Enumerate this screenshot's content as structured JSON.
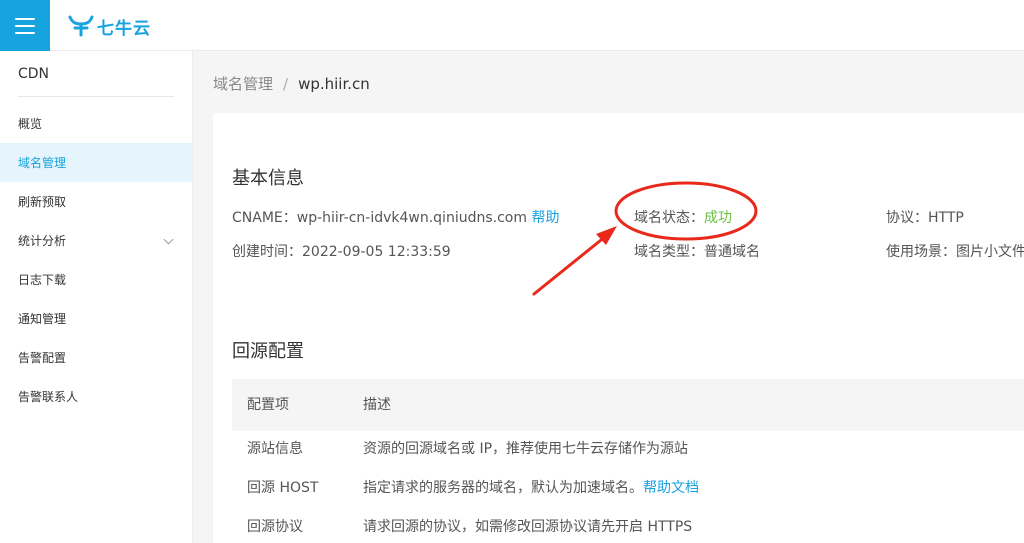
{
  "brand": {
    "name": "七牛云",
    "color": "#17a2e0"
  },
  "topbar": {
    "menu_icon": "hamburger-menu-icon"
  },
  "sidebar": {
    "title": "CDN",
    "items": [
      {
        "label": "概览"
      },
      {
        "label": "域名管理",
        "active": true
      },
      {
        "label": "刷新预取"
      },
      {
        "label": "统计分析",
        "expandable": true
      },
      {
        "label": "日志下载"
      },
      {
        "label": "通知管理"
      },
      {
        "label": "告警配置"
      },
      {
        "label": "告警联系人"
      }
    ]
  },
  "breadcrumb": {
    "parent": "域名管理",
    "separator": "/",
    "current": "wp.hiir.cn"
  },
  "basic_info": {
    "title": "基本信息",
    "cname_label": "CNAME：",
    "cname_value": "wp-hiir-cn-idvk4wn.qiniudns.com",
    "help_link": "帮助",
    "status_label": "域名状态：",
    "status_value": "成功",
    "protocol_label": "协议：",
    "protocol_value": "HTTP",
    "created_label": "创建时间：",
    "created_value": "2022-09-05 12:33:59",
    "type_label": "域名类型：",
    "type_value": "普通域名",
    "scene_label": "使用场景：",
    "scene_value": "图片小文件"
  },
  "origin_config": {
    "title": "回源配置",
    "columns": [
      "配置项",
      "描述"
    ],
    "rows": [
      {
        "item": "源站信息",
        "desc": "资源的回源域名或 IP，推荐使用七牛云存储作为源站",
        "link": ""
      },
      {
        "item": "回源 HOST",
        "desc": "指定请求的服务器的域名，默认为加速域名。",
        "link": "帮助文档"
      },
      {
        "item": "回源协议",
        "desc": "请求回源的协议，如需修改回源协议请先开启 HTTPS",
        "link": ""
      }
    ]
  },
  "colors": {
    "accent": "#17a2e0",
    "success": "#6cbf43",
    "annotation": "#e8291c"
  }
}
